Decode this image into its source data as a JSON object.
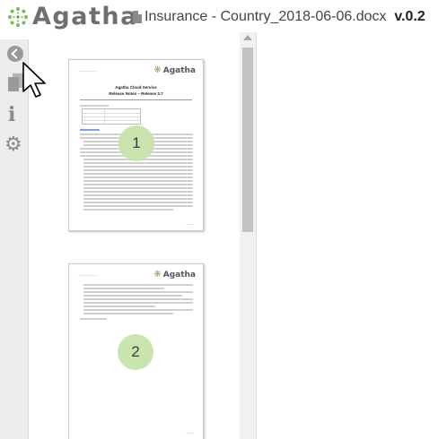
{
  "header": {
    "brand": "Agatha",
    "document_name": "Insurance - Country_2018-06-06.docx",
    "version_prefix": "v.",
    "version_number": "0.2",
    "colors": {
      "brand_text": "#6f6f6f",
      "logo_green": "#79b95a"
    }
  },
  "toolbar": {
    "items": [
      {
        "icon": "back-arrow-icon"
      },
      {
        "icon": "pages-icon"
      },
      {
        "icon": "info-icon"
      },
      {
        "icon": "settings-gear-icon"
      }
    ]
  },
  "thumbnails": {
    "pages": [
      {
        "number": "1",
        "logo": "Agatha",
        "title_line1": "Agatha Cloud Service",
        "title_line2": "Release Notes – Release 3.7"
      },
      {
        "number": "2",
        "logo": "Agatha"
      }
    ],
    "badge_color": "#c8e3ac"
  }
}
